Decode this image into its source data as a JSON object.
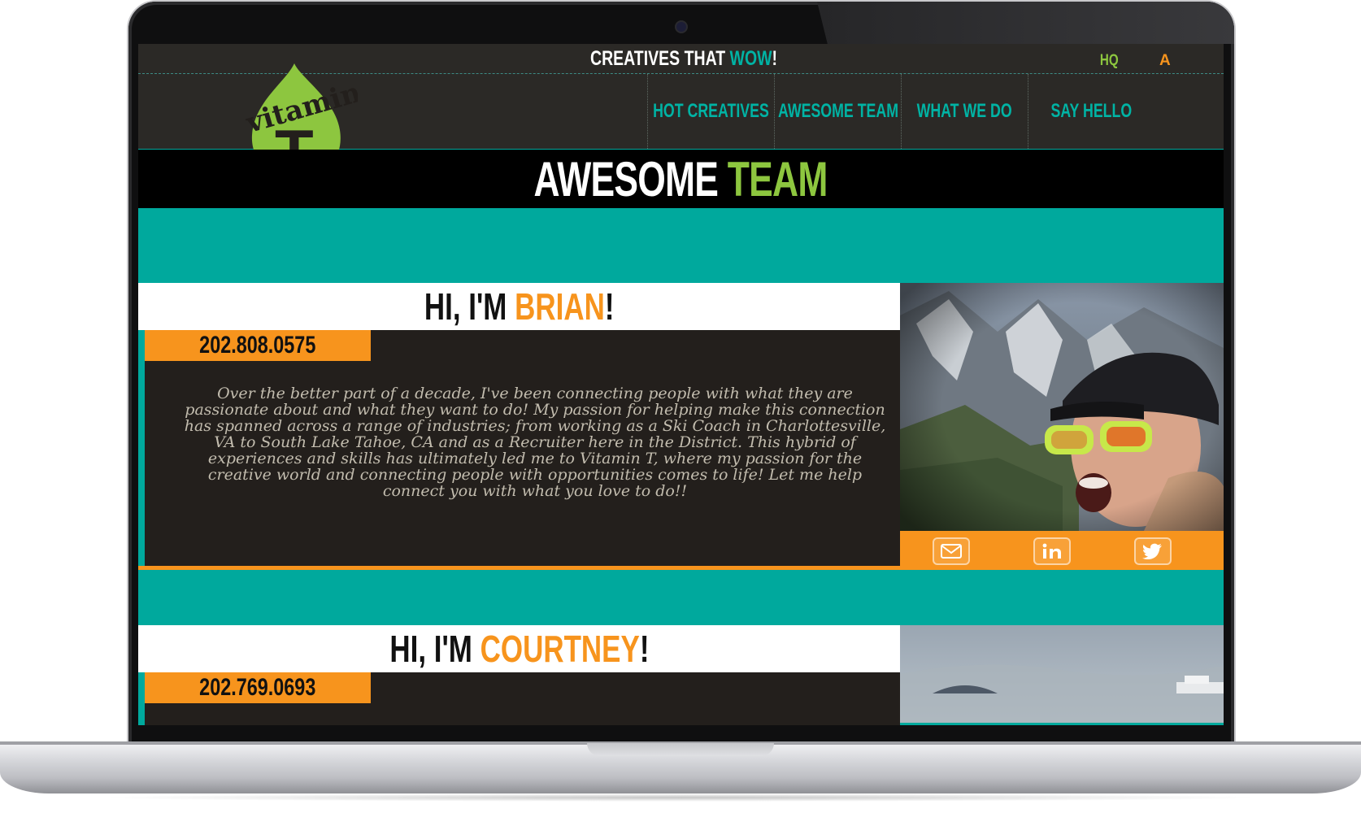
{
  "site": {
    "tagline_prefix": "CREATIVES THAT ",
    "tagline_highlight": "WOW",
    "tagline_suffix": "!",
    "utility_links": [
      "HQ",
      "A"
    ],
    "logo_text_top": "vitamin",
    "logo_text_letter": "T"
  },
  "nav": {
    "items": [
      "HOT CREATIVES",
      "AWESOME TEAM",
      "WHAT WE DO",
      "SAY HELLO"
    ]
  },
  "page": {
    "title_white": "AWESOME ",
    "title_green": "TEAM"
  },
  "team": [
    {
      "greeting_prefix": "HI, I'M ",
      "name": "BRIAN",
      "greeting_suffix": "!",
      "phone": "202.808.0575",
      "bio": "Over the better part of a decade, I've been connecting people with what they are passionate about and what they want to do! My passion for helping make this connection has spanned across a range of industries; from working as a Ski Coach in Charlottesville, VA to South Lake Tahoe, CA and as a Recruiter here in the District. This hybrid of experiences and skills has ultimately led me to Vitamin T, where my passion for the creative world and connecting people with opportunities comes to life! Let me help connect you with what you love to do!!",
      "social": [
        "email-icon",
        "linkedin-icon",
        "twitter-icon"
      ]
    },
    {
      "greeting_prefix": "HI, I'M ",
      "name": "COURTNEY",
      "greeting_suffix": "!",
      "phone": "202.769.0693"
    }
  ],
  "colors": {
    "teal": "#00a99d",
    "orange": "#f7941d",
    "green": "#8dc63f",
    "dark": "#2b2926"
  }
}
